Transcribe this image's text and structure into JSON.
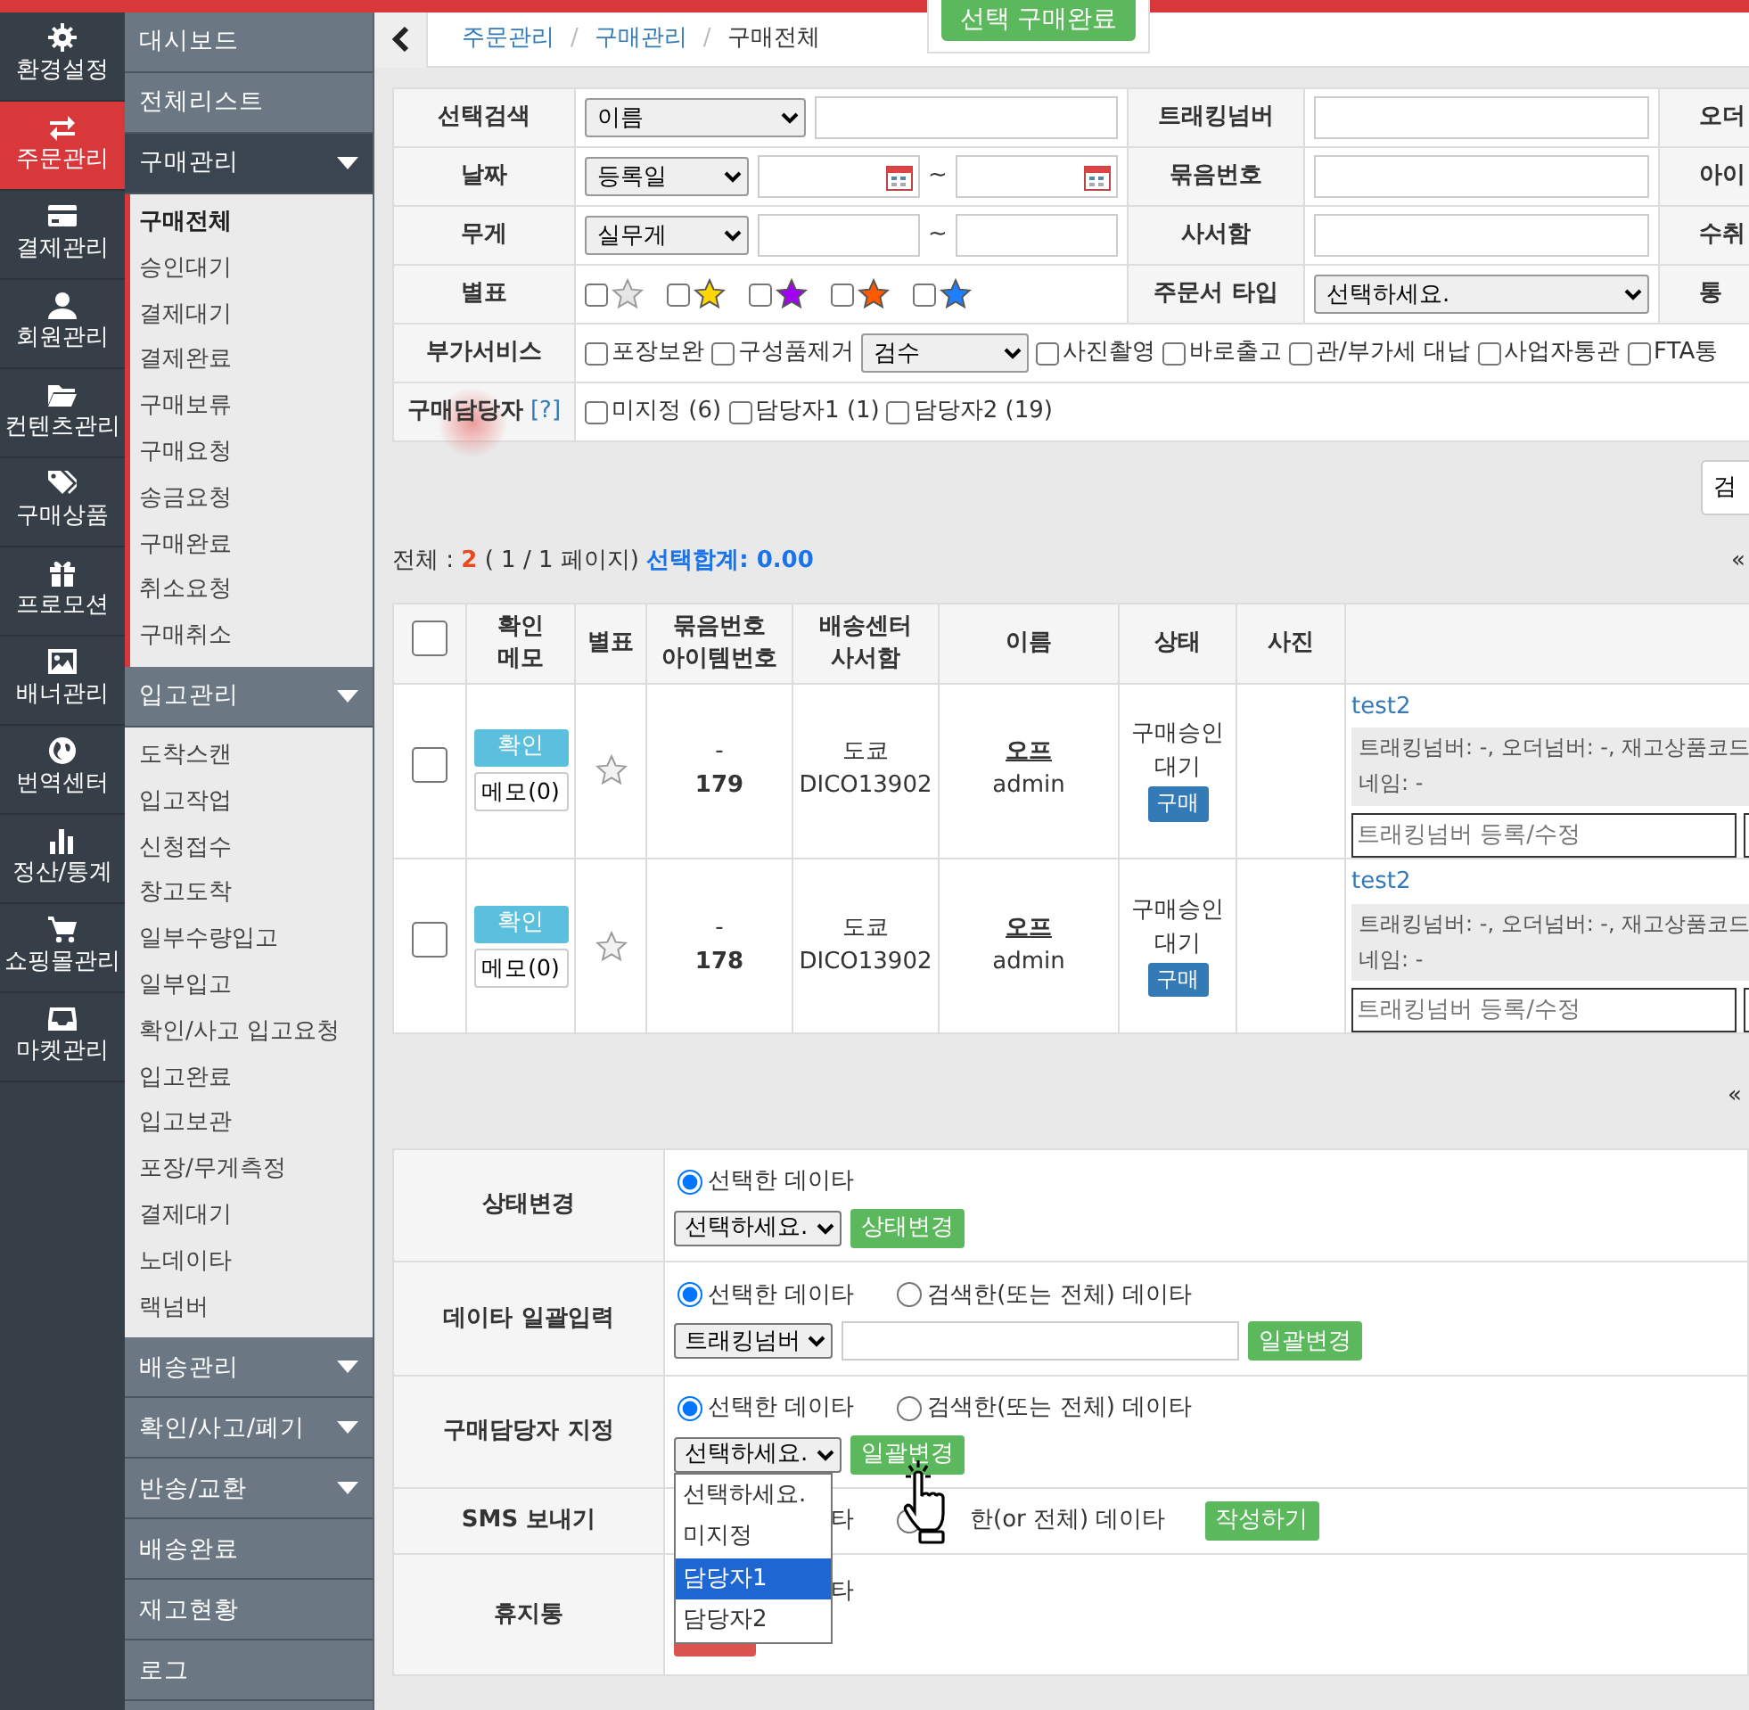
{
  "top_button": "선택 구매완료",
  "rail": [
    {
      "label": "환경설정",
      "selected": false
    },
    {
      "label": "주문관리",
      "selected": true
    },
    {
      "label": "결제관리",
      "selected": false
    },
    {
      "label": "회원관리",
      "selected": false
    },
    {
      "label": "컨텐츠관리",
      "selected": false
    },
    {
      "label": "구매상품",
      "selected": false
    },
    {
      "label": "프로모션",
      "selected": false
    },
    {
      "label": "배너관리",
      "selected": false
    },
    {
      "label": "번역센터",
      "selected": false
    },
    {
      "label": "정산/통계",
      "selected": false
    },
    {
      "label": "쇼핑몰관리",
      "selected": false
    },
    {
      "label": "마켓관리",
      "selected": false
    }
  ],
  "menu": [
    {
      "label": "대시보드",
      "kind": "link"
    },
    {
      "label": "전체리스트",
      "kind": "link"
    },
    {
      "label": "구매관리",
      "kind": "group",
      "selected": true,
      "expanded": true,
      "children": [
        {
          "label": "구매전체",
          "selected": true
        },
        {
          "label": "승인대기",
          "selected": false
        },
        {
          "label": "결제대기",
          "selected": false
        },
        {
          "label": "결제완료",
          "selected": false
        },
        {
          "label": "구매보류",
          "selected": false
        },
        {
          "label": "구매요청",
          "selected": false
        },
        {
          "label": "송금요청",
          "selected": false
        },
        {
          "label": "구매완료",
          "selected": false
        },
        {
          "label": "취소요청",
          "selected": false
        },
        {
          "label": "구매취소",
          "selected": false
        }
      ]
    },
    {
      "label": "입고관리",
      "kind": "group",
      "selected": false,
      "expanded": true,
      "children": [
        {
          "label": "도착스캔",
          "selected": false
        },
        {
          "label": "입고작업",
          "selected": false
        },
        {
          "label": "신청접수",
          "selected": false
        },
        {
          "label": "창고도착",
          "selected": false
        },
        {
          "label": "일부수량입고",
          "selected": false
        },
        {
          "label": "일부입고",
          "selected": false
        },
        {
          "label": "확인/사고 입고요청",
          "selected": false
        },
        {
          "label": "입고완료",
          "selected": false
        },
        {
          "label": "입고보관",
          "selected": false
        },
        {
          "label": "포장/무게측정",
          "selected": false
        },
        {
          "label": "결제대기",
          "selected": false
        },
        {
          "label": "노데이타",
          "selected": false
        },
        {
          "label": "랙넘버",
          "selected": false
        }
      ]
    },
    {
      "label": "배송관리",
      "kind": "group",
      "selected": false,
      "expanded": false
    },
    {
      "label": "확인/사고/폐기",
      "kind": "group",
      "selected": false,
      "expanded": false
    },
    {
      "label": "반송/교환",
      "kind": "group",
      "selected": false,
      "expanded": false
    },
    {
      "label": "배송완료",
      "kind": "link"
    },
    {
      "label": "재고현황",
      "kind": "link"
    },
    {
      "label": "로그",
      "kind": "link"
    }
  ],
  "breadcrumb": [
    {
      "label": "주문관리",
      "kind": "link"
    },
    {
      "label": "/",
      "kind": "separator"
    },
    {
      "label": "구매관리",
      "kind": "link"
    },
    {
      "label": "/",
      "kind": "separator"
    },
    {
      "label": "구매전체",
      "kind": "current"
    }
  ],
  "search": {
    "rows": [
      {
        "label": "선택검색",
        "fields": [
          {
            "kind": "select",
            "value": "이름"
          },
          {
            "kind": "input"
          }
        ],
        "label2": "트래킹넘버",
        "field2": {
          "kind": "input"
        },
        "label3": "오더"
      },
      {
        "label": "날짜",
        "fields": [
          {
            "kind": "select",
            "value": "등록일"
          },
          {
            "kind": "date"
          },
          {
            "kind": "text",
            "text": "~"
          },
          {
            "kind": "date"
          }
        ],
        "label2": "묶음번호",
        "field2": {
          "kind": "input"
        },
        "label3": "아이"
      },
      {
        "label": "무게",
        "fields": [
          {
            "kind": "select",
            "value": "실무게"
          },
          {
            "kind": "input"
          },
          {
            "kind": "text",
            "text": "~"
          },
          {
            "kind": "input"
          }
        ],
        "label2": "사서함",
        "field2": {
          "kind": "input"
        },
        "label3": "수취"
      },
      {
        "label": "별표",
        "fields": [
          {
            "kind": "star",
            "color": "#e6e6e6",
            "checked": false
          },
          {
            "kind": "star",
            "color": "#ffd700",
            "checked": false
          },
          {
            "kind": "star",
            "color": "#a100f2",
            "checked": false
          },
          {
            "kind": "star",
            "color": "#ff5a00",
            "checked": false
          },
          {
            "kind": "star",
            "color": "#1e80ff",
            "checked": false
          }
        ],
        "label2": "주문서 타입",
        "field2": {
          "kind": "select",
          "value": "선택하세요."
        },
        "label3": "통"
      },
      {
        "label": "부가서비스",
        "fields": [
          {
            "kind": "check",
            "label": "포장보완",
            "checked": false
          },
          {
            "kind": "check",
            "label": "구성품제거",
            "checked": false
          },
          {
            "kind": "select",
            "value": "검수"
          },
          {
            "kind": "check",
            "label": "사진촬영",
            "checked": false
          },
          {
            "kind": "check",
            "label": "바로출고",
            "checked": false
          },
          {
            "kind": "check",
            "label": "관/부가세 대납",
            "checked": false
          },
          {
            "kind": "check",
            "label": "사업자통관",
            "checked": false
          },
          {
            "kind": "check",
            "label": "FTA통",
            "checked": false
          }
        ]
      },
      {
        "label": "구매담당자",
        "help": "[?]",
        "fields": [
          {
            "kind": "check",
            "label": "미지정 (6)",
            "checked": false
          },
          {
            "kind": "check",
            "label": "담당자1 (1)",
            "checked": false
          },
          {
            "kind": "check",
            "label": "담당자2 (19)",
            "checked": false
          }
        ]
      }
    ],
    "button": "검"
  },
  "summary": {
    "label": "전체 :",
    "total": "2",
    "pages": "( 1 / 1 페이지)",
    "selection": "선택합계: 0.00"
  },
  "pagination_top": "«",
  "table": {
    "header_checked": false,
    "columns": [
      [
        "확인",
        "메모"
      ],
      [
        "별표"
      ],
      [
        "묶음번호",
        "아이템번호"
      ],
      [
        "배송센터",
        "사서함"
      ],
      [
        "이름"
      ],
      [
        "상태"
      ],
      [
        "사진"
      ]
    ],
    "rows": [
      {
        "checked": false,
        "confirm": "확인",
        "memo": "메모(0)",
        "starred": false,
        "bundle": "-",
        "item": "179",
        "center": "도쿄",
        "box": "DICO13902",
        "name": "오프",
        "user": "admin",
        "status": "구매승인 대기",
        "tag": "구매",
        "product": "test2",
        "info": "트래킹넘버: -, 오더넘버: -, 재고상품코드",
        "info2": "네임: -",
        "placeholder": "트래킹넘버 등록/수정"
      },
      {
        "checked": false,
        "confirm": "확인",
        "memo": "메모(0)",
        "starred": false,
        "bundle": "-",
        "item": "178",
        "center": "도쿄",
        "box": "DICO13902",
        "name": "오프",
        "user": "admin",
        "status": "구매승인 대기",
        "tag": "구매",
        "product": "test2",
        "info": "트래킹넘버: -, 오더넘버: -, 재고상품코드",
        "info2": "네임: -",
        "placeholder": "트래킹넘버 등록/수정"
      }
    ]
  },
  "pagination_bottom": "«",
  "actions": [
    {
      "label": "상태변경",
      "options": [
        {
          "kind": "radio",
          "label": "선택한 데이타",
          "selected": true
        }
      ],
      "select": "선택하세요.",
      "button": "상태변경",
      "kind": "apply"
    },
    {
      "label": "데이타 일괄입력",
      "options": [
        {
          "kind": "radio",
          "label": "선택한 데이타",
          "selected": true
        },
        {
          "kind": "radio",
          "label": "검색한(또는 전체) 데이타",
          "selected": false
        }
      ],
      "select": "트래킹넘버",
      "input": true,
      "button": "일괄변경",
      "kind": "apply"
    },
    {
      "label": "구매담당자 지정",
      "options": [
        {
          "kind": "radio",
          "label": "선택한 데이타",
          "selected": true
        },
        {
          "kind": "radio",
          "label": "검색한(또는 전체) 데이타",
          "selected": false
        }
      ],
      "select": "선택하세요.",
      "button": "일괄변경",
      "kind": "apply",
      "dropdown": [
        {
          "label": "선택하세요.",
          "selected": false
        },
        {
          "label": "미지정",
          "selected": false
        },
        {
          "label": "담당자1",
          "selected": true
        },
        {
          "label": "담당자2",
          "selected": false
        }
      ]
    },
    {
      "label": "SMS 보내기",
      "options": [
        {
          "kind": "fragment",
          "label": "타"
        },
        {
          "kind": "radio",
          "label": "한(or 전체) 데이타",
          "selected": false
        }
      ],
      "button": "작성하기",
      "kind": "apply"
    },
    {
      "label": "휴지통",
      "options": [
        {
          "kind": "fragment",
          "label": "타"
        }
      ],
      "kind": "delete"
    }
  ]
}
